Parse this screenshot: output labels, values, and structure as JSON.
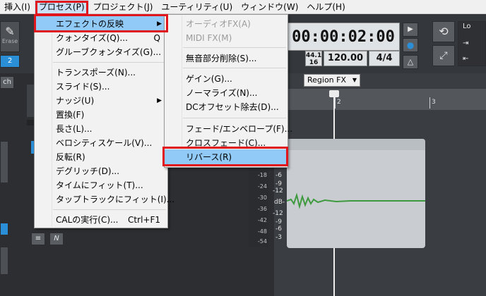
{
  "menubar": {
    "items": [
      "挿入(I)",
      "プロセス(P)",
      "プロジェクト(J)",
      "ユーティリティ(U)",
      "ウィンドウ(W)",
      "ヘルプ(H)"
    ],
    "active_index": 1
  },
  "process_menu": {
    "items": [
      {
        "label": "エフェクトの反映",
        "submenu": true,
        "selected": true
      },
      {
        "label": "クォンタイズ(Q)...",
        "shortcut": "Q"
      },
      {
        "label": "グルーブクォンタイズ(G)..."
      },
      {
        "label": "トランスポーズ(N)..."
      },
      {
        "label": "スライド(S)..."
      },
      {
        "label": "ナッジ(U)",
        "submenu": true
      },
      {
        "label": "置換(F)"
      },
      {
        "label": "長さ(L)..."
      },
      {
        "label": "ベロシティスケール(V)..."
      },
      {
        "label": "反転(R)"
      },
      {
        "label": "デグリッチ(D)..."
      },
      {
        "label": "タイムにフィット(T)..."
      },
      {
        "label": "タップトラックにフィット(I)..."
      },
      {
        "label": "CALの実行(C)...",
        "shortcut": "Ctrl+F1"
      }
    ]
  },
  "effects_submenu": {
    "items": [
      {
        "label": "オーディオFX(A)",
        "disabled": true
      },
      {
        "label": "MIDI FX(M)",
        "disabled": true
      },
      {
        "label": "無音部分削除(S)..."
      },
      {
        "label": "ゲイン(G)..."
      },
      {
        "label": "ノーマライズ(N)..."
      },
      {
        "label": "DCオフセット除去(D)..."
      },
      {
        "label": "フェード/エンベロープ(F)..."
      },
      {
        "label": "クロスフェード(C)..."
      },
      {
        "label": "リバース(R)",
        "selected": true
      }
    ]
  },
  "transport": {
    "time": "00:00:02:00",
    "sample_rate": "44.1",
    "bit_depth": "16",
    "tempo": "120.00",
    "meter": "4/4"
  },
  "left_panel": {
    "erase_label": "Erase",
    "number_badge": "2",
    "ch_label": "ch"
  },
  "track_view": {
    "region_fx_label": "Region FX",
    "ruler_numbers": [
      "2",
      "3"
    ],
    "db_label": "dB-",
    "meter_labels": [
      "-18",
      "-24",
      "-30",
      "-36",
      "-42",
      "-48",
      "-54"
    ],
    "scale_labels": [
      "-6",
      "-9",
      "-12",
      "-12",
      "-9",
      "-6",
      "-3"
    ],
    "topright_label": "Lo"
  },
  "colors": {
    "highlight": "#e0161c",
    "menu_selected": "#91c9f7",
    "waveform": "#3f9a3f"
  }
}
